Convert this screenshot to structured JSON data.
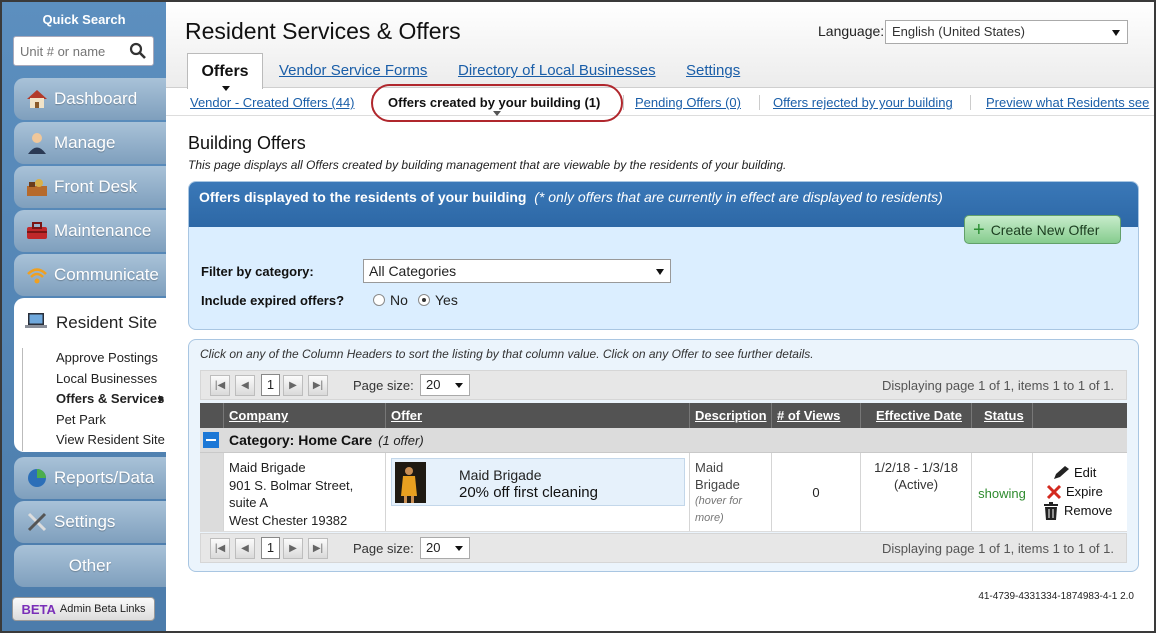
{
  "sidebar": {
    "quick_search_title": "Quick Search",
    "search_placeholder": "Unit # or name",
    "nav": {
      "dashboard": "Dashboard",
      "manage": "Manage",
      "front_desk": "Front Desk",
      "maintenance": "Maintenance",
      "communicate": "Communicate",
      "resident_site": "Resident Site",
      "reports": "Reports/Data",
      "settings": "Settings",
      "other": "Other"
    },
    "resident_site_items": [
      "Approve Postings",
      "Local Businesses",
      "Offers & Services",
      "Pet Park",
      "View Resident Site"
    ],
    "beta_tag": "BETA",
    "beta_label": "Admin Beta Links"
  },
  "header": {
    "title": "Resident Services & Offers",
    "language_label": "Language:",
    "language_value": "English (United States)",
    "tabs": [
      "Offers",
      "Vendor Service Forms",
      "Directory of Local Businesses",
      "Settings"
    ]
  },
  "subnav": {
    "links": [
      "Vendor - Created Offers (44)",
      "Offers created by your building (1)",
      "Pending Offers (0)",
      "Offers rejected by your building",
      "Preview what Residents see"
    ]
  },
  "content": {
    "section_title": "Building Offers",
    "section_desc": "This page displays all Offers created by building management that are viewable by the residents of your building.",
    "panel_title": "Offers displayed to the residents of your building",
    "panel_note": "(* only offers that are currently in effect are displayed to residents)",
    "create_button": "Create New Offer",
    "filter_label": "Filter by category:",
    "filter_value": "All Categories",
    "expired_label": "Include expired offers?",
    "radio_no": "No",
    "radio_yes": "Yes",
    "radio_selected": "Yes"
  },
  "grid": {
    "hint": "Click on any of the Column Headers to sort the listing by that column value. Click on any Offer to see further details.",
    "pager": {
      "current_page": "1",
      "page_size_label": "Page size:",
      "page_size": "20",
      "info": "Displaying page 1 of 1, items 1 to 1 of 1."
    },
    "columns": [
      "Company",
      "Offer",
      "Description",
      "# of Views",
      "Effective Date",
      "Status"
    ],
    "group": {
      "title": "Category: Home Care",
      "count": "(1 offer)"
    },
    "row": {
      "company_lines": [
        "Maid Brigade",
        "901 S. Bolmar Street,",
        "suite A",
        "West Chester 19382"
      ],
      "offer_name": "Maid Brigade",
      "offer_deal": "20% off first cleaning",
      "description": "Maid Brigade",
      "description_hint": "(hover for more)",
      "views": "0",
      "effective_dates": "1/2/18 - 1/3/18",
      "effective_status": "(Active)",
      "status": "showing",
      "actions": [
        "Edit",
        "Expire",
        "Remove"
      ]
    }
  },
  "footer": {
    "build_id": "41-4739-4331334-1874983-4-1 2.0"
  },
  "colors": {
    "sidebar_bg": "#5c8fbf",
    "panel_header": "#3a78b8",
    "link": "#1a5ea8",
    "highlight_ring": "#b0272d",
    "status_showing": "#2e8b2e",
    "create_green": "#86cc8e"
  },
  "icons": [
    "search-icon",
    "house-icon",
    "person-icon",
    "bell-desk-icon",
    "toolbox-icon",
    "wifi-icon",
    "laptop-icon",
    "pie-chart-icon",
    "tools-icon",
    "plus-icon",
    "first-page-icon",
    "prev-page-icon",
    "next-page-icon",
    "last-page-icon",
    "collapse-icon",
    "pen-icon",
    "x-icon",
    "trash-icon"
  ]
}
